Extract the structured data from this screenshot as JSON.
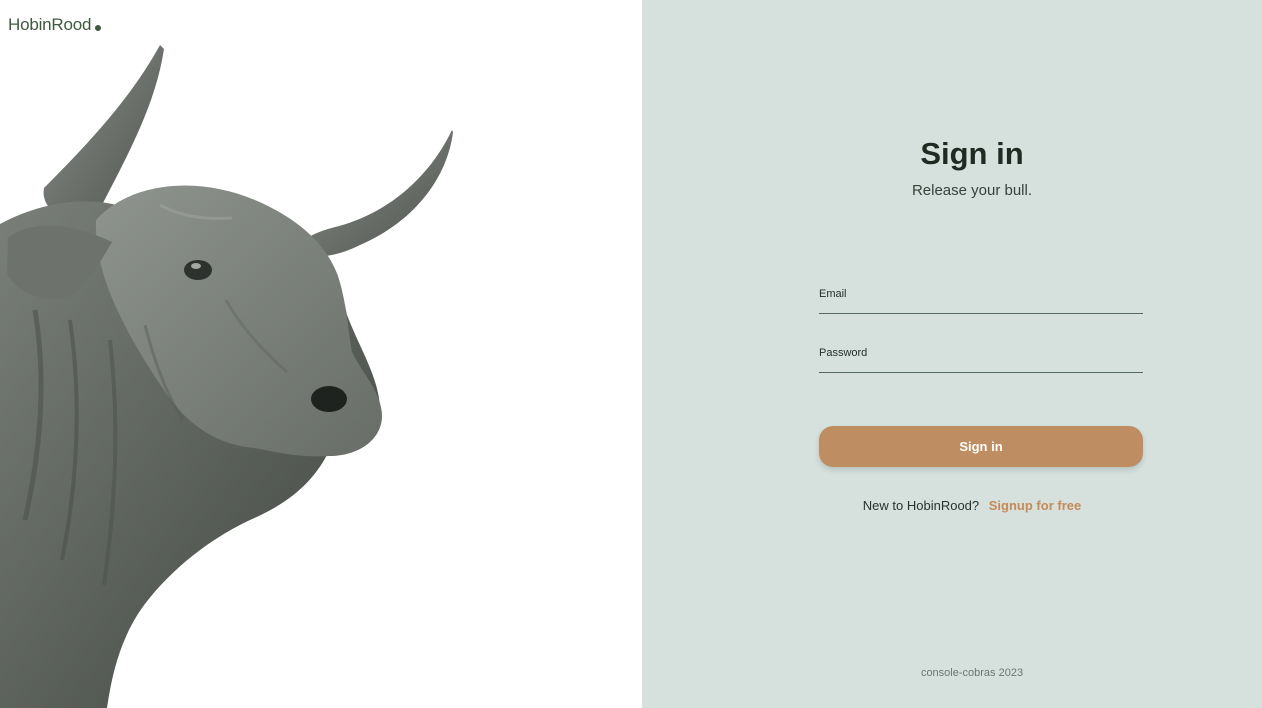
{
  "brand": {
    "name": "HobinRood"
  },
  "auth": {
    "title": "Sign in",
    "subtitle": "Release your bull.",
    "email_label": "Email",
    "email_value": "",
    "email_placeholder": "",
    "password_label": "Password",
    "password_value": "",
    "password_placeholder": "",
    "submit_label": "Sign in",
    "signup_prompt": "New to HobinRood?",
    "signup_link": "Signup for free"
  },
  "footer": {
    "text": "console-cobras 2023"
  },
  "colors": {
    "panel": "#d6e1de",
    "accent": "#bf8d62",
    "brand": "#3f5a40"
  },
  "icons": {
    "logo": "brand-dot-icon",
    "image": "bull-illustration"
  }
}
